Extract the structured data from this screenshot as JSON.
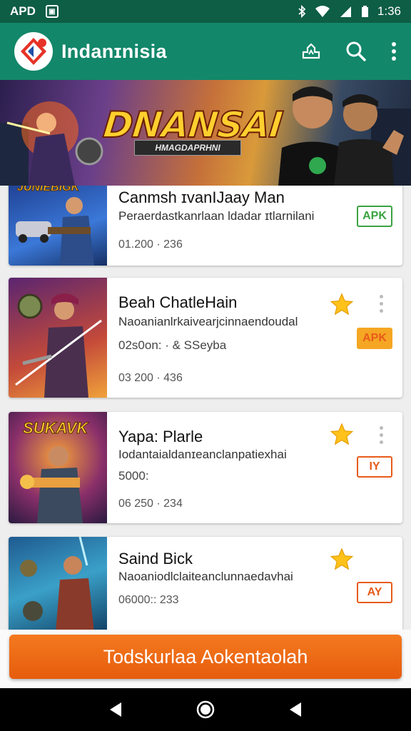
{
  "status_bar": {
    "left_text": "APD",
    "time": "1:36"
  },
  "app_bar": {
    "title": "Indanɪnisia",
    "icons": [
      "logo-icon",
      "rank-icon",
      "search-icon",
      "more-vert-icon"
    ]
  },
  "banner": {
    "title": "DNANSAI",
    "subtitle": "HMAGDAPRHNI"
  },
  "cards": [
    {
      "thumb_text": "JUNIEBIGK",
      "title": "Canmsh ɪvanIJaay Man",
      "desc": "Peraerdastkanrlaan ldadar ɪtlarnilani",
      "meta": "01.200 · 236",
      "badge": "APK",
      "badge_color": "#3aa33f",
      "starred": false
    },
    {
      "thumb_text": "",
      "title": "Beah ChatleHain",
      "desc": "Naoanianlrkaivearjcinnaendoudal",
      "extra": "02s0on: · & SSeyba",
      "meta": "03 200 · 436",
      "badge": "APK",
      "badge_color": "#f5a623",
      "starred": true
    },
    {
      "thumb_text": "SUKAVK",
      "title": "Yapa: Plarle",
      "desc": "Iodantaialdanɪeanclanpatiexhai",
      "extra": "5000:",
      "meta": "06 250 · 234",
      "badge": "IY",
      "badge_color": "#e85b1a",
      "starred": true
    },
    {
      "thumb_text": "",
      "title": "Saind Bick",
      "desc": "Naoaniodlclaiteanclunnaedavhai",
      "meta": "06000:: 233",
      "badge": "AY",
      "badge_color": "#e85b1a",
      "starred": true
    }
  ],
  "install_button": "Todskurlaa Aokentaolah",
  "colors": {
    "status_bar": "#0e5d45",
    "app_bar": "#12876a",
    "accent_orange": "#f26b1d",
    "star": "#ffc21a"
  }
}
